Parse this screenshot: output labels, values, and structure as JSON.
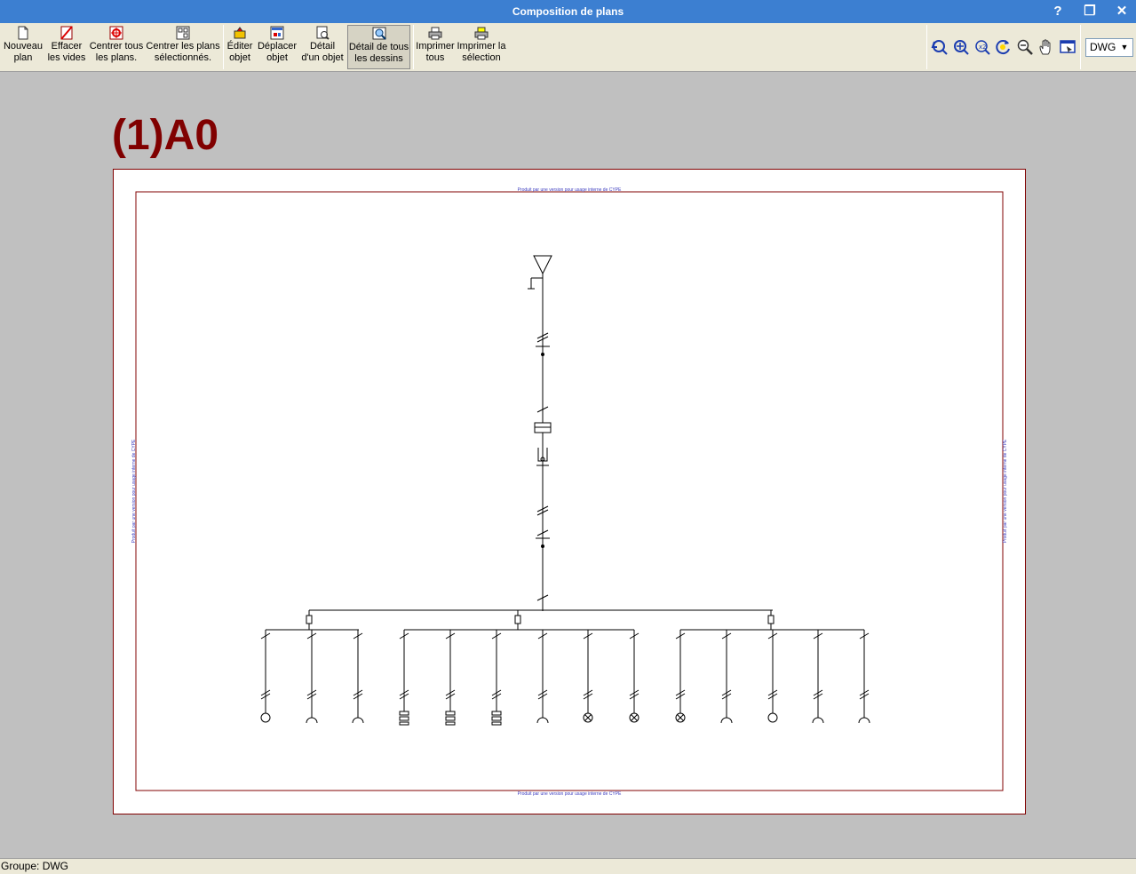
{
  "window": {
    "title": "Composition de plans",
    "help": "?",
    "restore": "❐",
    "close": "✕"
  },
  "toolbar": {
    "nouveau_plan": {
      "line1": "Nouveau",
      "line2": "plan"
    },
    "effacer_vides": {
      "line1": "Effacer",
      "line2": "les vides"
    },
    "centrer_tous": {
      "line1": "Centrer tous",
      "line2": "les plans."
    },
    "centrer_selection": {
      "line1": "Centrer les plans",
      "line2": "sélectionnés."
    },
    "editer_objet": {
      "line1": "Éditer",
      "line2": "objet"
    },
    "deplacer_objet": {
      "line1": "Déplacer",
      "line2": "objet"
    },
    "detail_objet": {
      "line1": "Détail",
      "line2": "d'un objet"
    },
    "detail_tous": {
      "line1": "Détail de tous",
      "line2": "les dessins"
    },
    "imprimer_tous": {
      "line1": "Imprimer",
      "line2": "tous"
    },
    "imprimer_selection": {
      "line1": "Imprimer la",
      "line2": "sélection"
    },
    "format_select": {
      "value": "DWG",
      "arrow": "▼"
    }
  },
  "plan": {
    "label": "(1)A0",
    "watermark": "Produit par une version pour usage interne de CYPE"
  },
  "status": {
    "text": "Groupe: DWG"
  },
  "colors": {
    "titlebar": "#3c7fd1",
    "plan_label": "#800000",
    "sheet_border": "#800000",
    "watermark": "#4040c0"
  }
}
